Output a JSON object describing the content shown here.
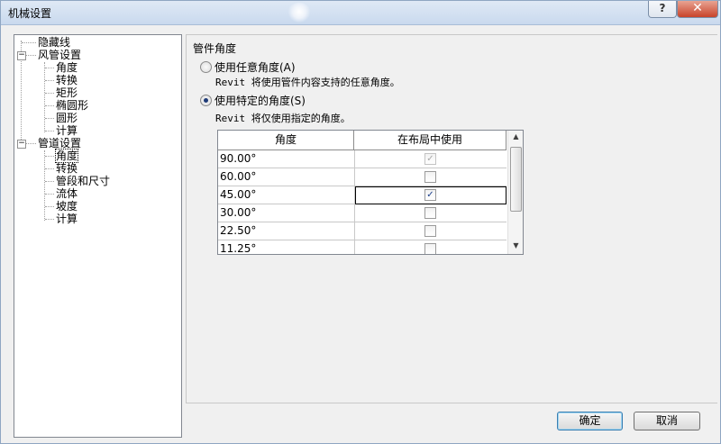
{
  "window": {
    "title": "机械设置",
    "help_label": "?",
    "close_label": "✕"
  },
  "icons": {
    "help": "help-icon",
    "close": "close-icon",
    "expand": "minus-box-icon",
    "check": "checkmark-icon",
    "scroll_up": "triangle-up-icon",
    "scroll_down": "triangle-down-icon"
  },
  "tree": {
    "hidden_lines": "隐藏线",
    "duct_settings": {
      "label": "风管设置",
      "expander": "−",
      "children": {
        "angle": "角度",
        "conversion": "转换",
        "rectangular": "矩形",
        "oval": "椭圆形",
        "round": "圆形",
        "calculation": "计算"
      }
    },
    "pipe_settings": {
      "label": "管道设置",
      "expander": "−",
      "children": {
        "angle": "角度",
        "conversion": "转换",
        "segments": "管段和尺寸",
        "fluids": "流体",
        "slope": "坡度",
        "calculation": "计算"
      }
    },
    "selected": "pipe_settings.angle"
  },
  "main": {
    "section_title": "管件角度",
    "option_any": {
      "label": "使用任意角度(A)",
      "desc": "Revit 将使用管件内容支持的任意角度。",
      "selected": false
    },
    "option_specific": {
      "label": "使用特定的角度(S)",
      "desc": "Revit 将仅使用指定的角度。",
      "selected": true
    },
    "grid": {
      "headers": {
        "angle": "角度",
        "use_in_layout": "在布局中使用"
      },
      "rows": [
        {
          "angle": "90.00°",
          "mark": "✓",
          "checked": true,
          "disabled": true
        },
        {
          "angle": "60.00°",
          "mark": "",
          "checked": false,
          "disabled": false
        },
        {
          "angle": "45.00°",
          "mark": "✓",
          "checked": true,
          "disabled": false
        },
        {
          "angle": "30.00°",
          "mark": "",
          "checked": false,
          "disabled": false
        },
        {
          "angle": "22.50°",
          "mark": "",
          "checked": false,
          "disabled": false
        },
        {
          "angle": "11.25°",
          "mark": "",
          "checked": false,
          "disabled": false
        }
      ],
      "scroll_up": "▲",
      "scroll_down": "▼"
    }
  },
  "buttons": {
    "ok": "确定",
    "cancel": "取消"
  },
  "colors": {
    "accent": "#1f3b77",
    "title_bar": "#dfe9f5",
    "close_button": "#c8432a",
    "default_button_border": "#3c7fb1"
  }
}
